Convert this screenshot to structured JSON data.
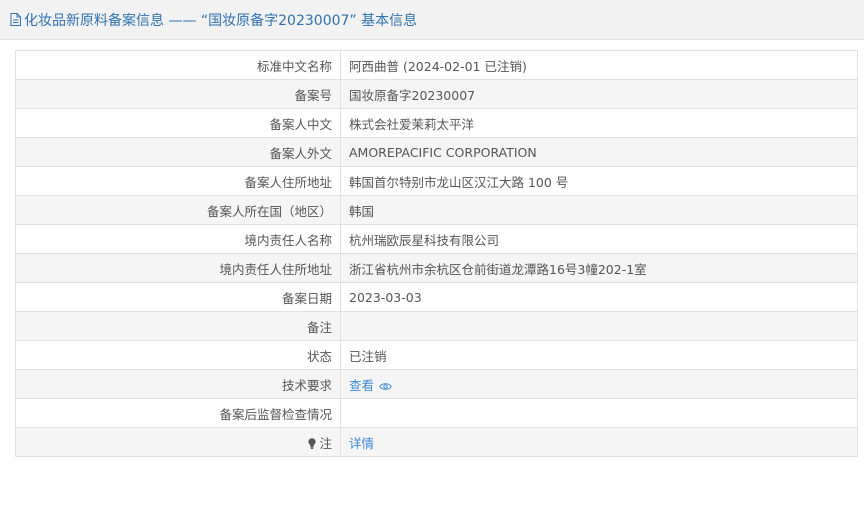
{
  "header": {
    "title": "化妆品新原料备案信息 —— “国妆原备字20230007” 基本信息"
  },
  "rows": [
    {
      "label": "标准中文名称",
      "value": "阿西曲普 (2024-02-01 已注销)"
    },
    {
      "label": "备案号",
      "value": "国妆原备字20230007"
    },
    {
      "label": "备案人中文",
      "value": "株式会社爱茉莉太平洋"
    },
    {
      "label": "备案人外文",
      "value": "AMOREPACIFIC CORPORATION"
    },
    {
      "label": "备案人住所地址",
      "value": "韩国首尔特别市龙山区汉江大路 100 号"
    },
    {
      "label": "备案人所在国（地区）",
      "value": "韩国"
    },
    {
      "label": "境内责任人名称",
      "value": "杭州瑞欧辰星科技有限公司"
    },
    {
      "label": "境内责任人住所地址",
      "value": "浙江省杭州市余杭区仓前街道龙潭路16号3幢202-1室"
    },
    {
      "label": "备案日期",
      "value": "2023-03-03"
    },
    {
      "label": "备注",
      "value": ""
    },
    {
      "label": "状态",
      "value": "已注销"
    },
    {
      "label": "技术要求",
      "value": "查看"
    },
    {
      "label": "备案后监督检查情况",
      "value": ""
    },
    {
      "label": "注",
      "value": "详情"
    }
  ],
  "icons": {
    "header": "document-icon",
    "tech": "eye-icon",
    "note": "lightbulb-icon"
  },
  "colors": {
    "title": "#2f73b0",
    "link": "#3b8bd4",
    "header_bg": "#f2f2f2",
    "row_alt": "#f5f5f5"
  }
}
